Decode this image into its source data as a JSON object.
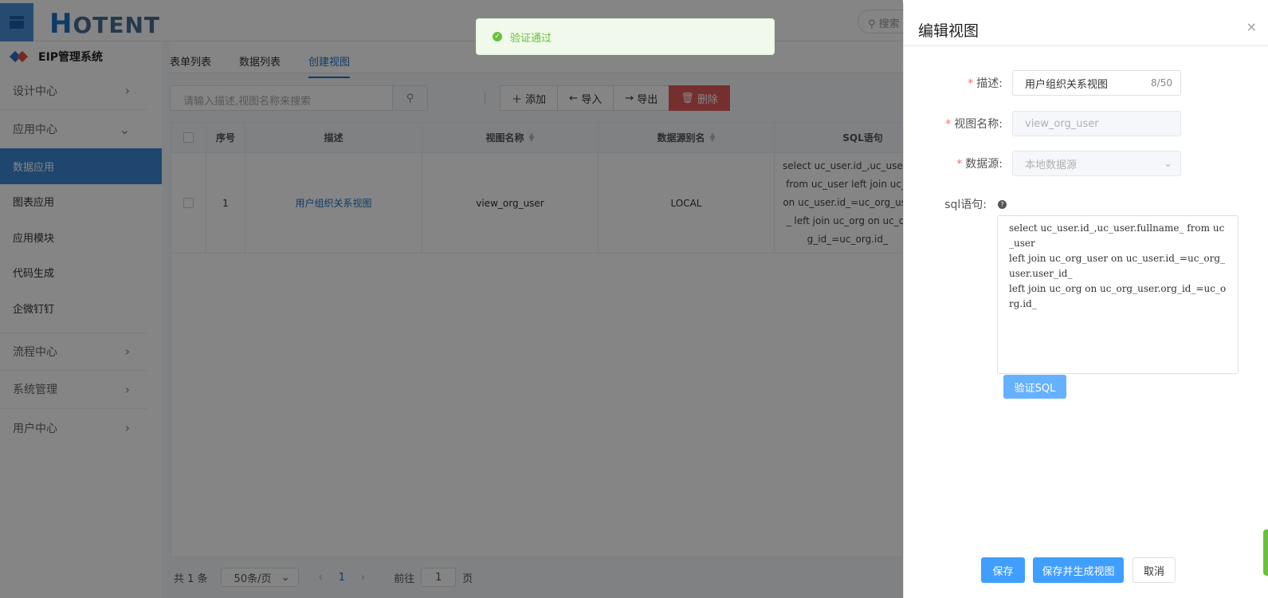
{
  "header": {
    "logo_h": "H",
    "logo_rest": "OTENT",
    "search_placeholder": "搜索"
  },
  "sidebar": {
    "brand": "EIP管理系统",
    "groups": [
      {
        "label": "设计中心",
        "chevron": "›"
      },
      {
        "label": "应用中心",
        "chevron": "⌄"
      }
    ],
    "sub_items": [
      {
        "label": "数据应用",
        "active": true
      },
      {
        "label": "图表应用"
      },
      {
        "label": "应用模块"
      },
      {
        "label": "代码生成"
      },
      {
        "label": "企微钉钉"
      }
    ],
    "groups_bottom": [
      {
        "label": "流程中心",
        "chevron": "›"
      },
      {
        "label": "系统管理",
        "chevron": "›"
      },
      {
        "label": "用户中心",
        "chevron": "›"
      }
    ]
  },
  "main": {
    "tabs": [
      "表单列表",
      "数据列表",
      "创建视图"
    ],
    "active_tab": "创建视图",
    "search_placeholder": "请输入描述,视图名称来搜索",
    "buttons": {
      "add": "添加",
      "import": "导入",
      "export": "导出",
      "delete": "删除"
    },
    "table": {
      "columns": [
        "序号",
        "描述",
        "视图名称",
        "数据源别名",
        "SQL语句"
      ],
      "rows": [
        {
          "index": "1",
          "description": "用户组织关系视图",
          "view_name": "view_org_user",
          "datasource_alias": "LOCAL",
          "sql": "select uc_user.id_,uc_user.f\n from uc_user left join uc_o\non uc_user.id_=uc_org_use\n_ left join uc_org on uc_or\ng_id_=uc_org.id_"
        }
      ]
    },
    "pager": {
      "total": "共 1 条",
      "page_size": "50条/页",
      "current_page": "1",
      "goto_label": "前往",
      "goto_value": "1",
      "page_suffix": "页"
    }
  },
  "toast": {
    "message": "验证通过"
  },
  "drawer": {
    "title": "编辑视图",
    "close": "×",
    "fields": {
      "description_label": "描述:",
      "description_value": "用户组织关系视图",
      "description_count": "8/50",
      "view_name_label": "视图名称:",
      "view_name_value": "view_org_user",
      "datasource_label": "数据源:",
      "datasource_value": "本地数据源",
      "sql_label": "sql语句:",
      "sql_value": "select uc_user.id_,uc_user.fullname_ from uc_user\nleft join uc_org_user on uc_user.id_=uc_org_user.user_id_\nleft join uc_org on uc_org_user.org_id_=uc_org.id_"
    },
    "verify_button": "验证SQL",
    "footer": {
      "save": "保存",
      "save_generate": "保存并生成视图",
      "cancel": "取消"
    }
  },
  "colors": {
    "primary": "#409eff",
    "active_nav": "#3a86d4",
    "danger": "#e05a5a",
    "success": "#67c23a"
  }
}
